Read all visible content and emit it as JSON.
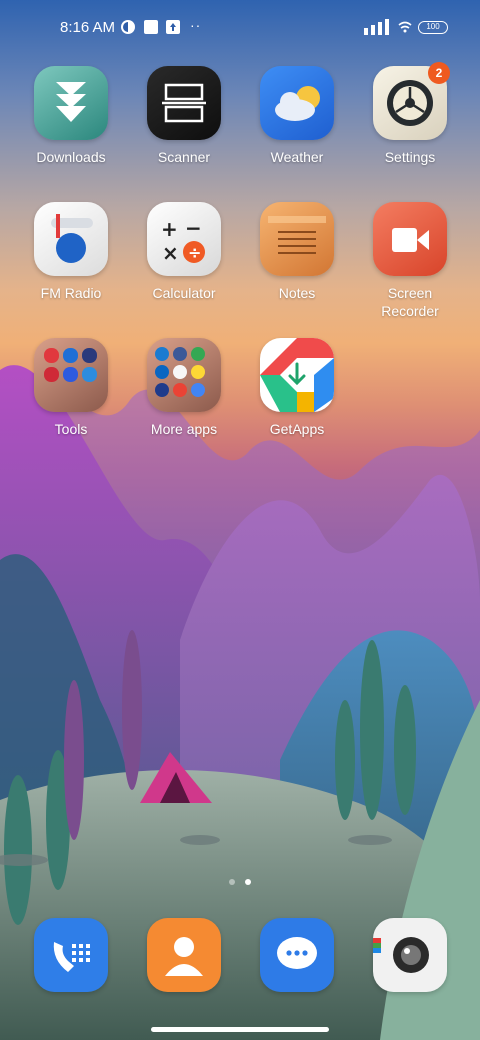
{
  "status_bar": {
    "time": "8:16 AM",
    "battery": "100",
    "icons": [
      "moon-clock-icon",
      "screenshot-icon",
      "upload-icon",
      "more-dots-icon",
      "signal-icon",
      "wifi-icon",
      "battery-icon"
    ]
  },
  "apps": [
    {
      "label": "Downloads",
      "icon": "download-arrows-icon"
    },
    {
      "label": "Scanner",
      "icon": "scanner-icon"
    },
    {
      "label": "Weather",
      "icon": "cloud-sun-icon"
    },
    {
      "label": "Settings",
      "icon": "gear-icon",
      "badge": "2"
    },
    {
      "label": "FM Radio",
      "icon": "radio-icon"
    },
    {
      "label": "Calculator",
      "icon": "calculator-icon"
    },
    {
      "label": "Notes",
      "icon": "notes-icon"
    },
    {
      "label": "Screen\nRecorder",
      "icon": "video-camera-icon"
    },
    {
      "label": "Tools",
      "icon": "folder-icon"
    },
    {
      "label": "More apps",
      "icon": "folder-icon"
    },
    {
      "label": "GetApps",
      "icon": "getapps-download-icon"
    }
  ],
  "dock": [
    {
      "name": "phone",
      "icon": "phone-icon"
    },
    {
      "name": "contacts",
      "icon": "contacts-icon"
    },
    {
      "name": "messages",
      "icon": "message-icon"
    },
    {
      "name": "camera",
      "icon": "camera-icon"
    }
  ],
  "page_indicator": {
    "pages": 2,
    "current": 2
  },
  "colors": {
    "badge": "#ef5a1f",
    "text": "#ffffff"
  }
}
